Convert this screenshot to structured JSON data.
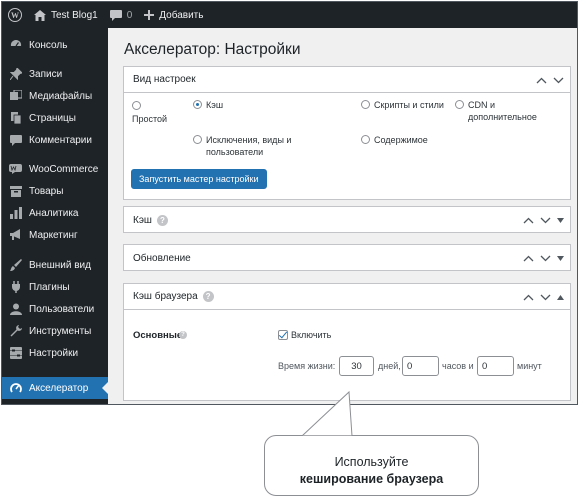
{
  "adminbar": {
    "site_name": "Test Blog1",
    "comments_count": "0",
    "add_new_label": "Добавить"
  },
  "sidebar": {
    "items": [
      {
        "label": "Консоль",
        "icon": "dashboard-icon"
      },
      {
        "label": "Записи",
        "icon": "pin-icon"
      },
      {
        "label": "Медиафайлы",
        "icon": "media-icon"
      },
      {
        "label": "Страницы",
        "icon": "page-icon"
      },
      {
        "label": "Комментарии",
        "icon": "comment-icon"
      },
      {
        "label": "WooCommerce",
        "icon": "woo-icon"
      },
      {
        "label": "Товары",
        "icon": "archive-icon"
      },
      {
        "label": "Аналитика",
        "icon": "bar-chart-icon"
      },
      {
        "label": "Маркетинг",
        "icon": "megaphone-icon"
      },
      {
        "label": "Внешний вид",
        "icon": "brush-icon"
      },
      {
        "label": "Плагины",
        "icon": "plugin-icon"
      },
      {
        "label": "Пользователи",
        "icon": "users-icon"
      },
      {
        "label": "Инструменты",
        "icon": "wrench-icon"
      },
      {
        "label": "Настройки",
        "icon": "settings-icon"
      },
      {
        "label": "Акселератор",
        "icon": "accelerator-icon",
        "active": true
      }
    ]
  },
  "page": {
    "title": "Акселератор: Настройки"
  },
  "settings_view": {
    "title": "Вид настроек",
    "options": {
      "simple": "Простой",
      "cache": "Кэш",
      "scripts": "Скрипты и стили",
      "cdn": "CDN и дополнительное",
      "exclusions": "Исключения, виды и пользователи",
      "content": "Содержимое"
    },
    "selected": "Кэш",
    "wizard_button": "Запустить мастер настройки"
  },
  "cache_panel": {
    "title": "Кэш"
  },
  "update_panel": {
    "title": "Обновление"
  },
  "browser_cache_panel": {
    "title": "Кэш браузера",
    "basic_label": "Основные",
    "enable_label": "Включить",
    "enabled": true,
    "lifetime_label": "Время жизни:",
    "days_value": "30",
    "days_unit": "дней,",
    "hours_value": "0",
    "hours_unit": "часов и",
    "minutes_value": "0",
    "minutes_unit": "минут"
  },
  "callout": {
    "line1": "Используйте",
    "line2": "кеширование браузера"
  },
  "colors": {
    "accent": "#2271b1",
    "sidebar_bg": "#1d2327",
    "page_bg": "#f0f0f1"
  }
}
